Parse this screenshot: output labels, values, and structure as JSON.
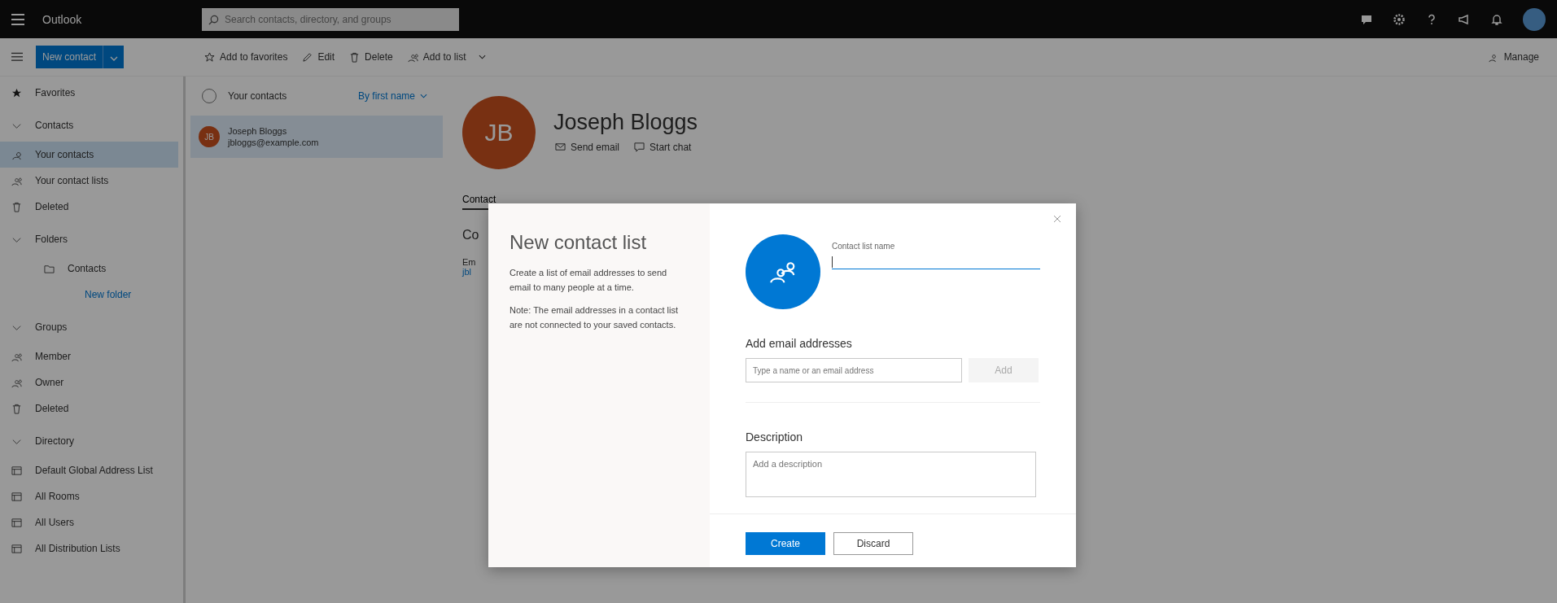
{
  "app_bar": {
    "title": "Outlook",
    "search": {
      "placeholder": "Search contacts, directory, and groups"
    }
  },
  "toolbar": {
    "new_button": "New contact",
    "actions": [
      {
        "kind": "star",
        "label": "Add to favorites"
      },
      {
        "kind": "pencil",
        "label": "Edit"
      },
      {
        "kind": "trash",
        "label": "Delete"
      },
      {
        "kind": "people",
        "label": "Add to list"
      }
    ],
    "manage": "Manage"
  },
  "sidebar": [
    {
      "kind": "favorites",
      "label": "Favorites"
    },
    {
      "kind": "section",
      "label": "Contacts",
      "expanded": true,
      "children": [
        {
          "kind": "person",
          "label": "Your contacts",
          "selected": true
        },
        {
          "kind": "people",
          "label": "Your contact lists",
          "selected": false
        },
        {
          "kind": "trash",
          "label": "Deleted",
          "selected": false
        },
        {
          "kind": "section",
          "label": "Folders",
          "expanded": true,
          "children": [
            {
              "kind": "folder",
              "label": "Contacts",
              "selected": false
            },
            {
              "kind": "link",
              "label": "New folder",
              "selected": false
            }
          ]
        }
      ]
    },
    {
      "kind": "section",
      "label": "Groups",
      "expanded": true,
      "children": [
        {
          "kind": "people",
          "label": "Member",
          "selected": false
        },
        {
          "kind": "people",
          "label": "Owner",
          "selected": false
        },
        {
          "kind": "trash",
          "label": "Deleted",
          "selected": false
        }
      ]
    },
    {
      "kind": "section",
      "label": "Directory",
      "expanded": true,
      "children": [
        {
          "kind": "list",
          "label": "Default Global Address List",
          "selected": false
        },
        {
          "kind": "list",
          "label": "All Rooms",
          "selected": false
        },
        {
          "kind": "list",
          "label": "All Users",
          "selected": false
        },
        {
          "kind": "list",
          "label": "All Distribution Lists",
          "selected": false
        }
      ]
    }
  ],
  "contact_list": {
    "checked": false,
    "title": "Your contacts",
    "sort": "By first name",
    "contacts": [
      {
        "initials": "JB",
        "name": "Joseph Bloggs",
        "email": "jbloggs@example.com",
        "selected": true
      }
    ]
  },
  "contact_detail": {
    "initials": "JB",
    "name": "Joseph Bloggs",
    "actions": [
      {
        "kind": "mail",
        "label": "Send email"
      },
      {
        "kind": "chat",
        "label": "Start chat"
      }
    ],
    "tabs": [
      {
        "label": "Contact",
        "selected": true
      }
    ],
    "section_heading": "Co",
    "field_label": "Em",
    "field_value": "jbl"
  },
  "dialog": {
    "title": "New contact list",
    "paragraphs": [
      "Create a list of email addresses to send email to many people at a time.",
      "Note: The email addresses in a contact list are not connected to your saved contacts."
    ],
    "name_field": {
      "label": "Contact list name"
    },
    "add_section": {
      "heading": "Add email addresses",
      "placeholder": "Type a name or an email address",
      "button": {
        "label": "Add",
        "disabled": true
      }
    },
    "description": {
      "heading": "Description",
      "placeholder": "Add a description"
    },
    "buttons": [
      {
        "kind": "primary",
        "label": "Create"
      },
      {
        "kind": "default",
        "label": "Discard"
      }
    ]
  }
}
